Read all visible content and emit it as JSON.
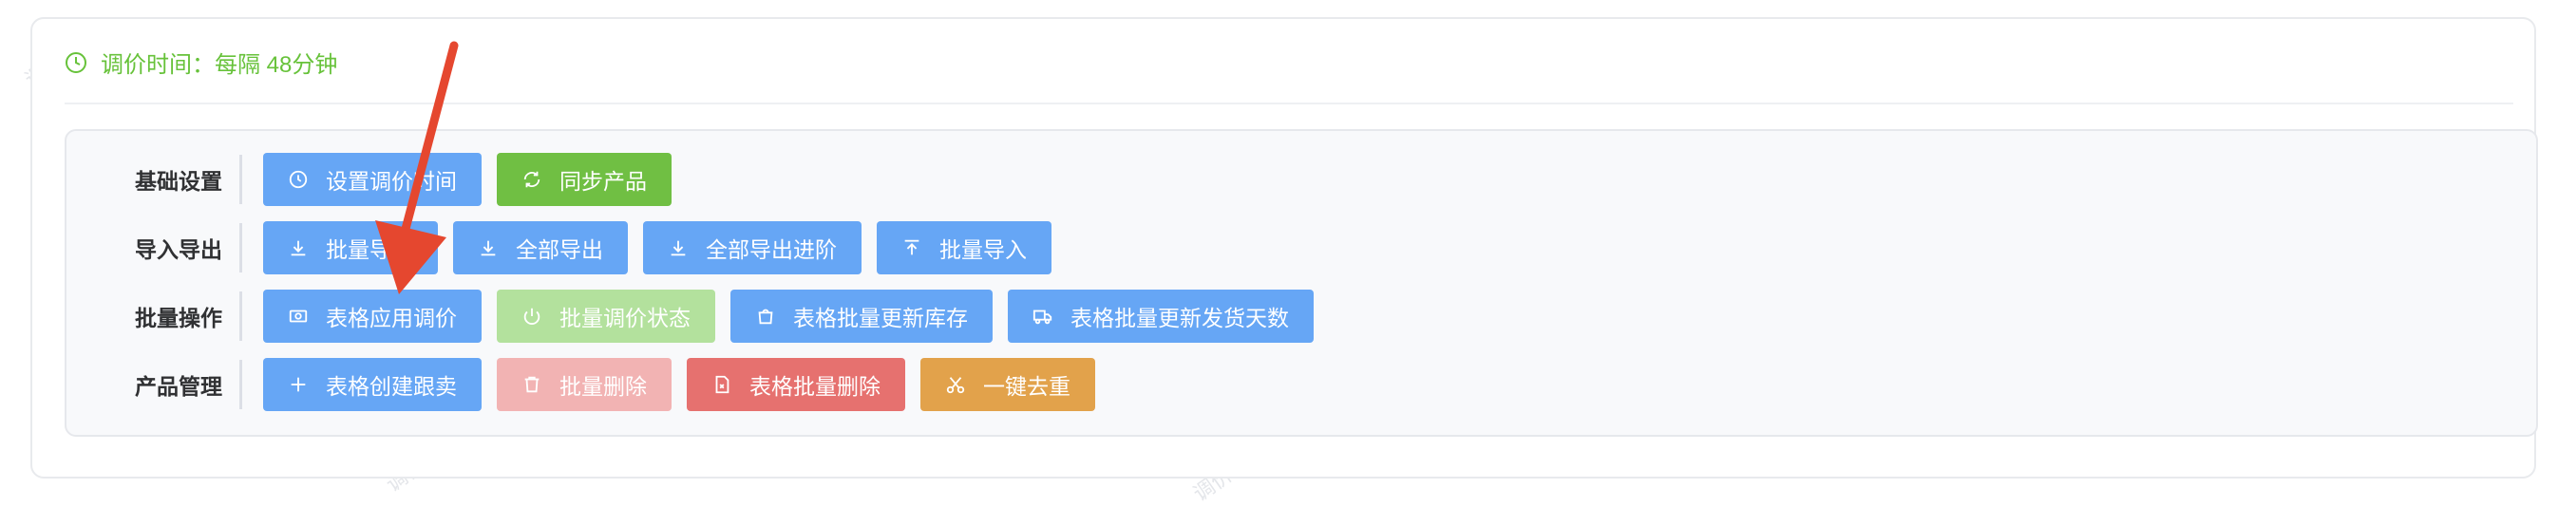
{
  "colors": {
    "primary": "#66a6f5",
    "success": "#70bf43",
    "success_disabled": "#b3e19d",
    "danger_disabled": "#f2b3b3",
    "danger": "#e6716f",
    "warning": "#e2a24b",
    "annotation_arrow": "#e5472f"
  },
  "header": {
    "interval_text": "调价时间：每隔 48分钟",
    "icon": "clock-icon"
  },
  "watermark_text": "调价先锋",
  "rows": [
    {
      "label": "基础设置",
      "buttons": [
        {
          "label": "设置调价时间",
          "icon": "clock-icon",
          "color": "blue"
        },
        {
          "label": "同步产品",
          "icon": "refresh-icon",
          "color": "green"
        }
      ]
    },
    {
      "label": "导入导出",
      "buttons": [
        {
          "label": "批量导出",
          "icon": "download-icon",
          "color": "blue"
        },
        {
          "label": "全部导出",
          "icon": "download-icon",
          "color": "blue"
        },
        {
          "label": "全部导出进阶",
          "icon": "download-icon",
          "color": "blue"
        },
        {
          "label": "批量导入",
          "icon": "upload-icon",
          "color": "blue"
        }
      ]
    },
    {
      "label": "批量操作",
      "buttons": [
        {
          "label": "表格应用调价",
          "icon": "money-icon",
          "color": "blue"
        },
        {
          "label": "批量调价状态",
          "icon": "power-icon",
          "color": "green-disabled"
        },
        {
          "label": "表格批量更新库存",
          "icon": "bag-icon",
          "color": "blue"
        },
        {
          "label": "表格批量更新发货天数",
          "icon": "truck-icon",
          "color": "blue"
        }
      ]
    },
    {
      "label": "产品管理",
      "buttons": [
        {
          "label": "表格创建跟卖",
          "icon": "plus-icon",
          "color": "blue"
        },
        {
          "label": "批量删除",
          "icon": "trash-icon",
          "color": "red-disabled"
        },
        {
          "label": "表格批量删除",
          "icon": "doc-delete-icon",
          "color": "red"
        },
        {
          "label": "一键去重",
          "icon": "scissors-icon",
          "color": "orange"
        }
      ]
    }
  ]
}
